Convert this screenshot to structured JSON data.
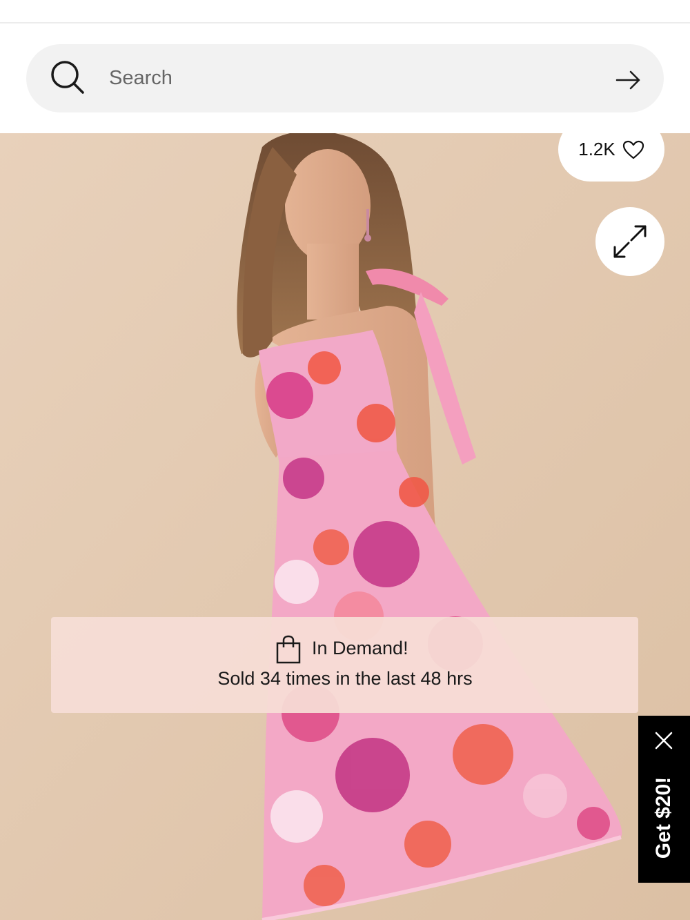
{
  "search": {
    "placeholder": "Search"
  },
  "product": {
    "likes": "1.2K",
    "demand_title": "In Demand!",
    "demand_subtitle": "Sold 34 times in the last 48 hrs"
  },
  "promo": {
    "label": "Get $20!"
  },
  "icons": [
    "search-icon",
    "arrow-right-icon",
    "heart-icon",
    "expand-icon",
    "shopping-bag-icon",
    "close-icon"
  ],
  "colors": {
    "background": "#e6cdb5",
    "dress_pink": "#f2a9c8",
    "banner": "#f6ded6",
    "promo_bg": "#000000"
  }
}
